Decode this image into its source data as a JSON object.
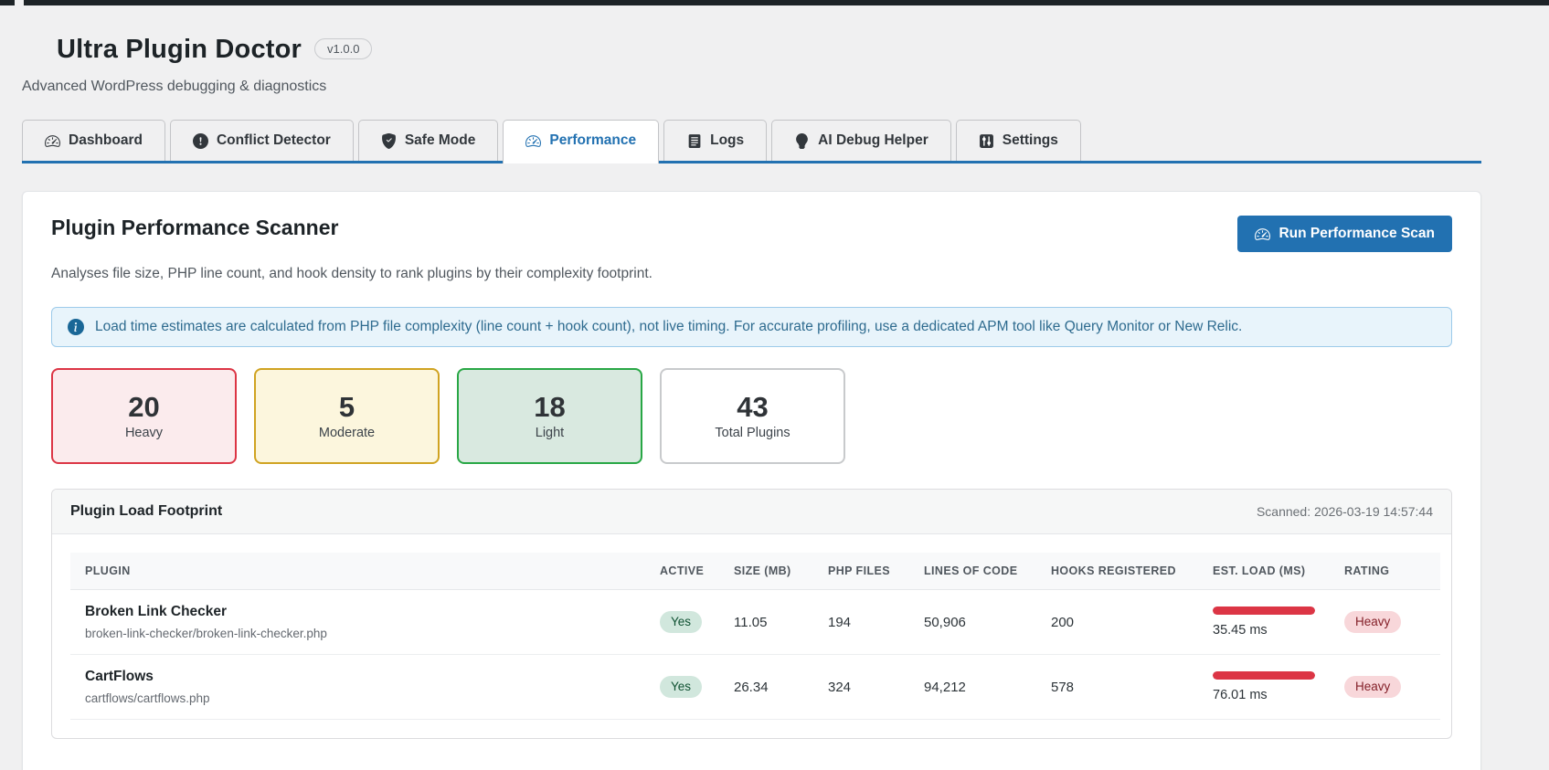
{
  "header": {
    "title": "Ultra Plugin Doctor",
    "version": "v1.0.0",
    "subtitle": "Advanced WordPress debugging & diagnostics"
  },
  "tabs": [
    {
      "label": "Dashboard",
      "icon": "speedometer-icon",
      "active": false
    },
    {
      "label": "Conflict Detector",
      "icon": "exclamation-circle-icon",
      "active": false
    },
    {
      "label": "Safe Mode",
      "icon": "shield-check-icon",
      "active": false
    },
    {
      "label": "Performance",
      "icon": "speedometer-icon",
      "active": true
    },
    {
      "label": "Logs",
      "icon": "journal-icon",
      "active": false
    },
    {
      "label": "AI Debug Helper",
      "icon": "lightbulb-icon",
      "active": false
    },
    {
      "label": "Settings",
      "icon": "sliders-icon",
      "active": false
    }
  ],
  "panel": {
    "title": "Plugin Performance Scanner",
    "subtitle": "Analyses file size, PHP line count, and hook density to rank plugins by their complexity footprint.",
    "scan_button": "Run Performance Scan",
    "scan_button_icon": "speedometer-icon",
    "alert_icon": "info-icon",
    "alert": "Load time estimates are calculated from PHP file complexity (line count + hook count), not live timing. For accurate profiling, use a dedicated APM tool like Query Monitor or New Relic.",
    "accent_color": "#2271b1"
  },
  "stats": [
    {
      "value": "20",
      "label": "Heavy",
      "border": "#dc3545",
      "bg": "#fbebed"
    },
    {
      "value": "5",
      "label": "Moderate",
      "border": "#d0a321",
      "bg": "#fcf6dd"
    },
    {
      "value": "18",
      "label": "Light",
      "border": "#28a745",
      "bg": "#d9e9e0"
    },
    {
      "value": "43",
      "label": "Total Plugins",
      "border": "#c8cacc",
      "bg": "#ffffff"
    }
  ],
  "footprint": {
    "title": "Plugin Load Footprint",
    "scanned": "Scanned: 2026-03-19 14:57:44",
    "columns": [
      "PLUGIN",
      "ACTIVE",
      "SIZE (MB)",
      "PHP FILES",
      "LINES OF CODE",
      "HOOKS REGISTERED",
      "EST. LOAD (MS)",
      "RATING"
    ],
    "rows": [
      {
        "name": "Broken Link Checker",
        "path": "broken-link-checker/broken-link-checker.php",
        "active": "Yes",
        "size_mb": "11.05",
        "php_files": "194",
        "lines_of_code": "50,906",
        "hooks_registered": "200",
        "load_ms": "35.45 ms",
        "load_pct": 100,
        "rating": "Heavy",
        "bar_color": "#dc3545"
      },
      {
        "name": "CartFlows",
        "path": "cartflows/cartflows.php",
        "active": "Yes",
        "size_mb": "26.34",
        "php_files": "324",
        "lines_of_code": "94,212",
        "hooks_registered": "578",
        "load_ms": "76.01 ms",
        "load_pct": 100,
        "rating": "Heavy",
        "bar_color": "#dc3545"
      }
    ]
  }
}
